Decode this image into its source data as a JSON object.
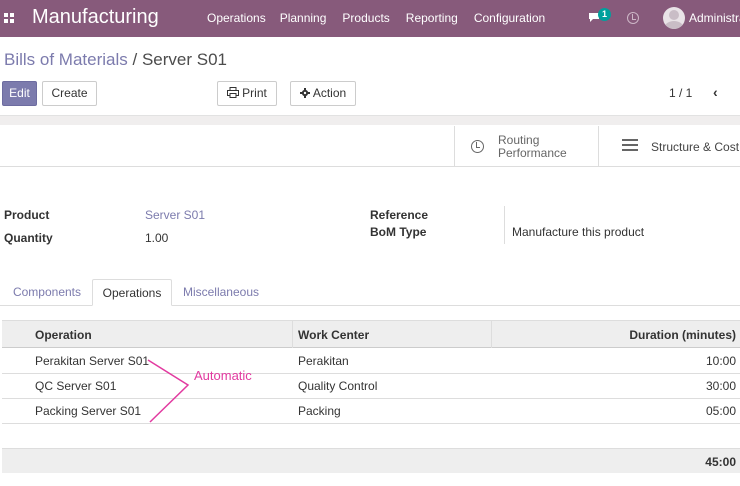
{
  "navbar": {
    "app_title": "Manufacturing",
    "menu": [
      "Operations",
      "Planning",
      "Products",
      "Reporting",
      "Configuration"
    ],
    "chat_count": "1",
    "user": "Administrator"
  },
  "breadcrumb": {
    "parent": "Bills of Materials",
    "separator": " / ",
    "current": "Server S01"
  },
  "toolbar": {
    "edit": "Edit",
    "create": "Create",
    "print": "Print",
    "action": "Action",
    "pager": "1 / 1"
  },
  "smart_buttons": {
    "routing_line1": "Routing",
    "routing_line2": "Performance",
    "structure": "Structure & Cost"
  },
  "fields": {
    "product_label": "Product",
    "product_value": "Server S01",
    "quantity_label": "Quantity",
    "quantity_value": "1.00",
    "reference_label": "Reference",
    "reference_value": "",
    "bom_type_label": "BoM Type",
    "bom_type_value": "Manufacture this product"
  },
  "tabs": [
    "Components",
    "Operations",
    "Miscellaneous"
  ],
  "table": {
    "headers": [
      "Operation",
      "Work Center",
      "Duration (minutes)"
    ],
    "rows": [
      {
        "operation": "Perakitan Server S01",
        "work_center": "Perakitan",
        "duration": "10:00"
      },
      {
        "operation": "QC Server S01",
        "work_center": "Quality Control",
        "duration": "30:00"
      },
      {
        "operation": "Packing Server S01",
        "work_center": "Packing",
        "duration": "05:00"
      }
    ],
    "total": "45:00"
  },
  "annotation": {
    "text": "Automatic",
    "color": "#e23aa0"
  },
  "colors": {
    "navbar": "#875a7b",
    "primary": "#7c7bad",
    "badge": "#00a09d"
  }
}
